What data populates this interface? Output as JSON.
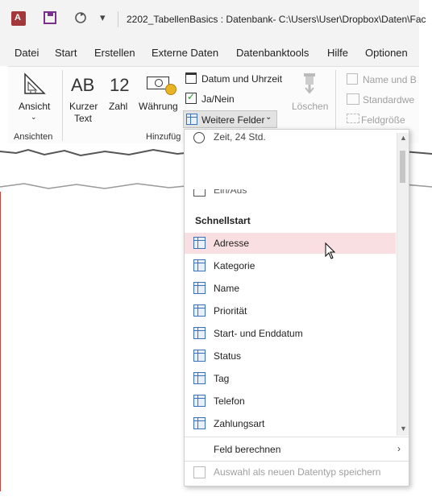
{
  "window": {
    "title": "2202_TabellenBasics : Datenbank- C:\\Users\\User\\Dropbox\\Daten\\Fac"
  },
  "quick_access": {
    "customize_glyph": "▾"
  },
  "menu": {
    "tabs": [
      "Datei",
      "Start",
      "Erstellen",
      "Externe Daten",
      "Datenbanktools",
      "Hilfe",
      "Optionen"
    ]
  },
  "ribbon": {
    "views": {
      "button": "Ansicht",
      "group": "Ansichten"
    },
    "add_delete": {
      "short_text_line1": "Kurzer",
      "short_text_line2": "Text",
      "short_text_glyph": "AB",
      "number": "Zahl",
      "number_glyph": "12",
      "currency": "Währung",
      "date_time": "Datum und Uhrzeit",
      "yes_no": "Ja/Nein",
      "more_fields": "Weitere Felder",
      "delete": "Löschen",
      "group": "Hinzufüg"
    },
    "properties": {
      "name": "Name und B",
      "default": "Standardwe",
      "field_size": "Feldgröße"
    }
  },
  "dropdown": {
    "top_item": "Zeit, 24 Std.",
    "partial_item": "Ein/Aus",
    "section_header": "Schnellstart",
    "items": [
      "Adresse",
      "Kategorie",
      "Name",
      "Priorität",
      "Start- und Enddatum",
      "Status",
      "Tag",
      "Telefon",
      "Zahlungsart"
    ],
    "highlighted_index": 0,
    "calc_field": "Feld berechnen",
    "save_as_type": "Auswahl als neuen Datentyp speichern"
  }
}
